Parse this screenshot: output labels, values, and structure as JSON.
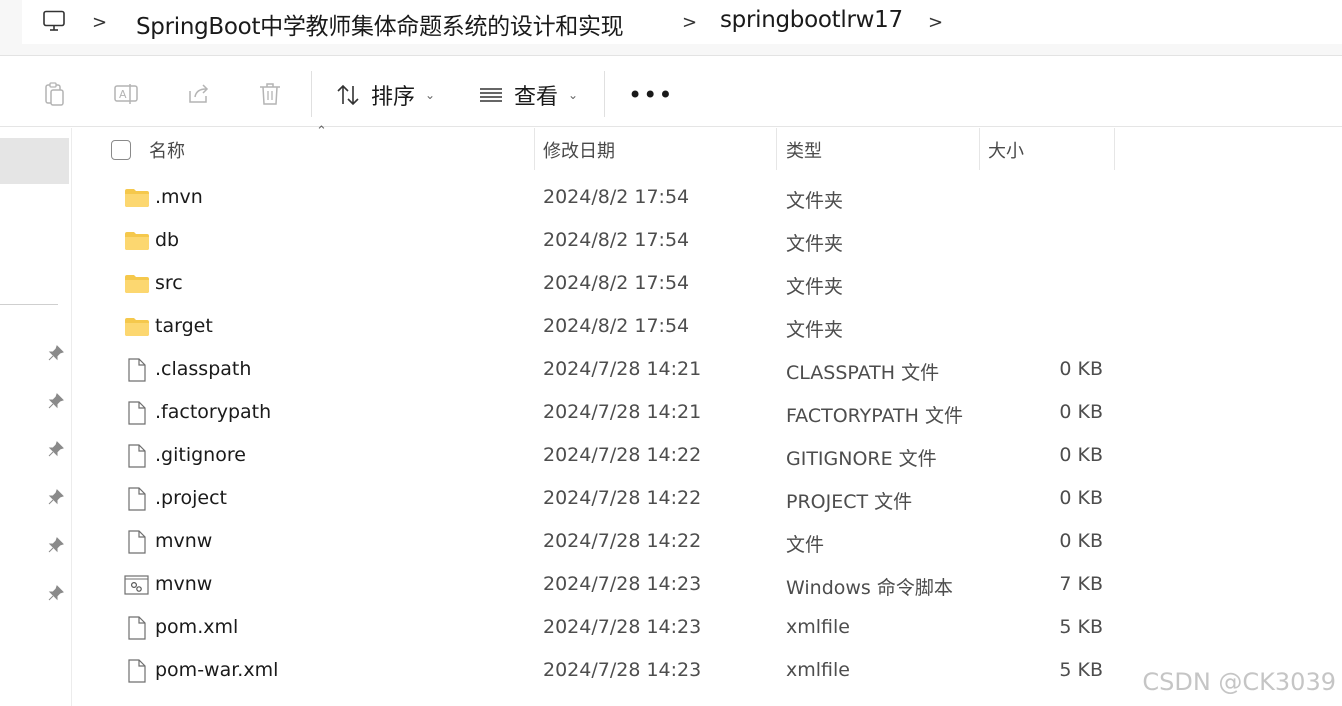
{
  "breadcrumb": {
    "items": [
      {
        "label": "SpringBoot中学教师集体命题系统的设计和实现"
      },
      {
        "label": "springbootlrw17"
      }
    ],
    "separator": ">"
  },
  "toolbar": {
    "sort_label": "排序",
    "view_label": "查看",
    "more_label": "•••"
  },
  "columns": {
    "name": "名称",
    "date": "修改日期",
    "type": "类型",
    "size": "大小"
  },
  "files": [
    {
      "name": ".mvn",
      "date": "2024/8/2 17:54",
      "type": "文件夹",
      "size": "",
      "icon": "folder-icon"
    },
    {
      "name": "db",
      "date": "2024/8/2 17:54",
      "type": "文件夹",
      "size": "",
      "icon": "folder-icon"
    },
    {
      "name": "src",
      "date": "2024/8/2 17:54",
      "type": "文件夹",
      "size": "",
      "icon": "folder-icon"
    },
    {
      "name": "target",
      "date": "2024/8/2 17:54",
      "type": "文件夹",
      "size": "",
      "icon": "folder-icon"
    },
    {
      "name": ".classpath",
      "date": "2024/7/28 14:21",
      "type": "CLASSPATH 文件",
      "size": "0 KB",
      "icon": "file-icon"
    },
    {
      "name": ".factorypath",
      "date": "2024/7/28 14:21",
      "type": "FACTORYPATH 文件",
      "size": "0 KB",
      "icon": "file-icon"
    },
    {
      "name": ".gitignore",
      "date": "2024/7/28 14:22",
      "type": "GITIGNORE 文件",
      "size": "0 KB",
      "icon": "file-icon"
    },
    {
      "name": ".project",
      "date": "2024/7/28 14:22",
      "type": "PROJECT 文件",
      "size": "0 KB",
      "icon": "file-icon"
    },
    {
      "name": "mvnw",
      "date": "2024/7/28 14:22",
      "type": "文件",
      "size": "0 KB",
      "icon": "file-icon"
    },
    {
      "name": "mvnw",
      "date": "2024/7/28 14:23",
      "type": "Windows 命令脚本",
      "size": "7 KB",
      "icon": "script-icon"
    },
    {
      "name": "pom.xml",
      "date": "2024/7/28 14:23",
      "type": "xmlfile",
      "size": "5 KB",
      "icon": "file-icon"
    },
    {
      "name": "pom-war.xml",
      "date": "2024/7/28 14:23",
      "type": "xmlfile",
      "size": "5 KB",
      "icon": "file-icon"
    }
  ],
  "watermark": "CSDN @CK3039",
  "colors": {
    "folder": "#f5c84c",
    "selection": "#e5e5e5"
  }
}
